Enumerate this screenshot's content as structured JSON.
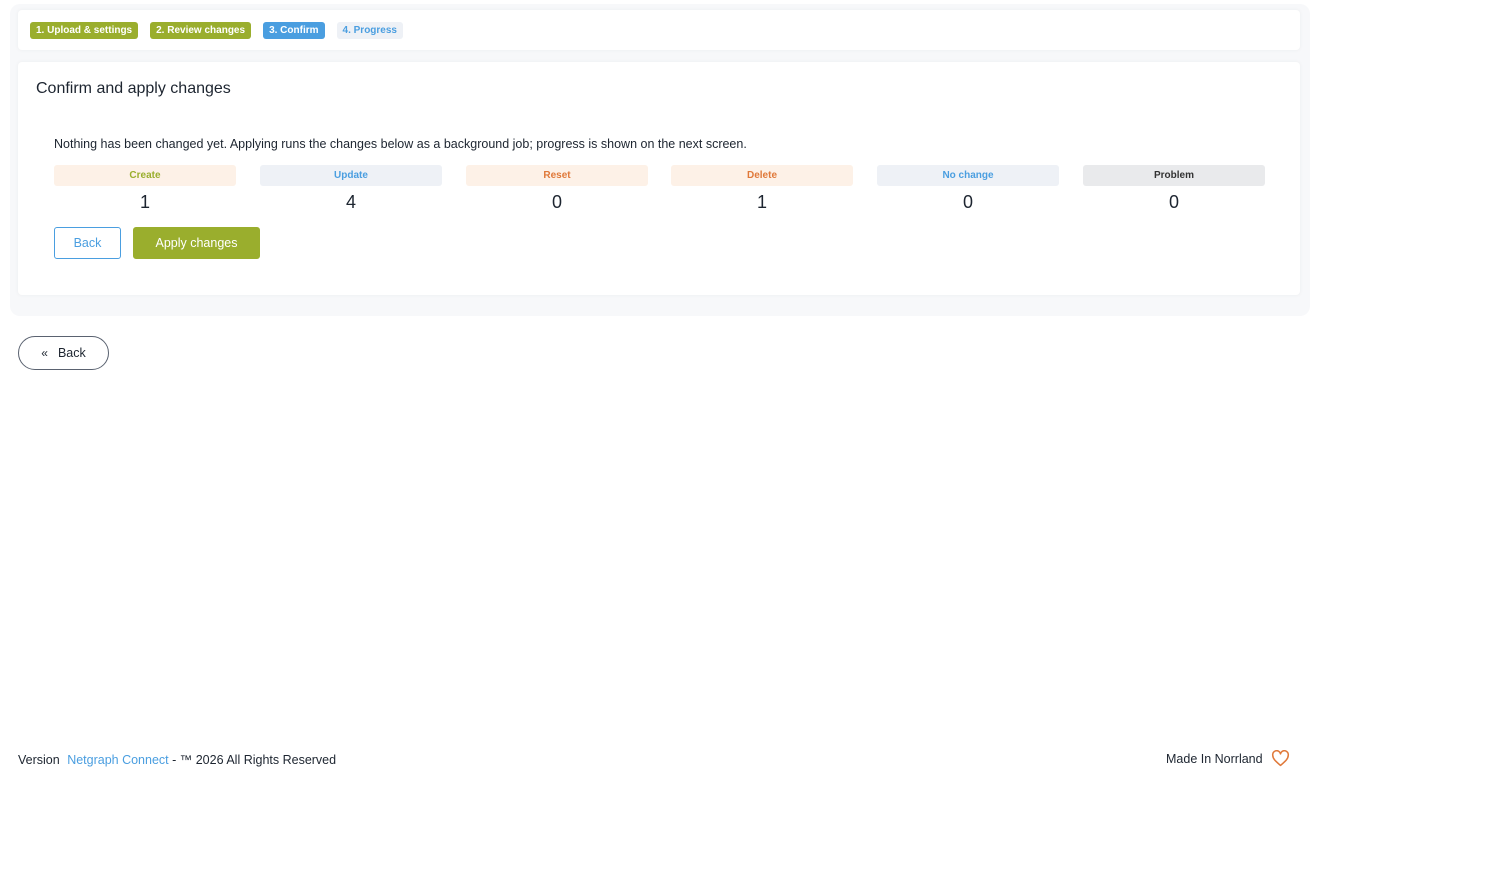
{
  "steps": [
    {
      "label": "1. Upload & settings",
      "state": "done"
    },
    {
      "label": "2. Review changes",
      "state": "done"
    },
    {
      "label": "3. Confirm",
      "state": "current"
    },
    {
      "label": "4. Progress",
      "state": "pending"
    }
  ],
  "card": {
    "title": "Confirm and apply changes",
    "info": "Nothing has been changed yet. Applying runs the changes below as a background job; progress is shown on the next screen.",
    "stats": [
      {
        "label": "Create",
        "value": "1",
        "bg": "#fdf1e7",
        "color": "#9aae2d"
      },
      {
        "label": "Update",
        "value": "4",
        "bg": "#eef1f6",
        "color": "#4a9ee0"
      },
      {
        "label": "Reset",
        "value": "0",
        "bg": "#fdf1e7",
        "color": "#e0793a"
      },
      {
        "label": "Delete",
        "value": "1",
        "bg": "#fdf1e7",
        "color": "#e0793a"
      },
      {
        "label": "No change",
        "value": "0",
        "bg": "#eef1f6",
        "color": "#4a9ee0"
      },
      {
        "label": "Problem",
        "value": "0",
        "bg": "#e9eaec",
        "color": "#333333"
      }
    ],
    "back_label": "Back",
    "apply_label": "Apply changes"
  },
  "nav": {
    "back_label": "Back",
    "back_icon": "double-chevron-left-icon"
  },
  "footer": {
    "version_label": "Version",
    "product_link": "Netgraph Connect",
    "rights": "- ™ 2026 All Rights Reserved",
    "made_in": "Made In Norrland",
    "heart_icon": "heart-icon"
  },
  "colors": {
    "accent_green": "#9aae2d",
    "accent_blue": "#4a9ee0",
    "accent_orange": "#e0793a"
  }
}
